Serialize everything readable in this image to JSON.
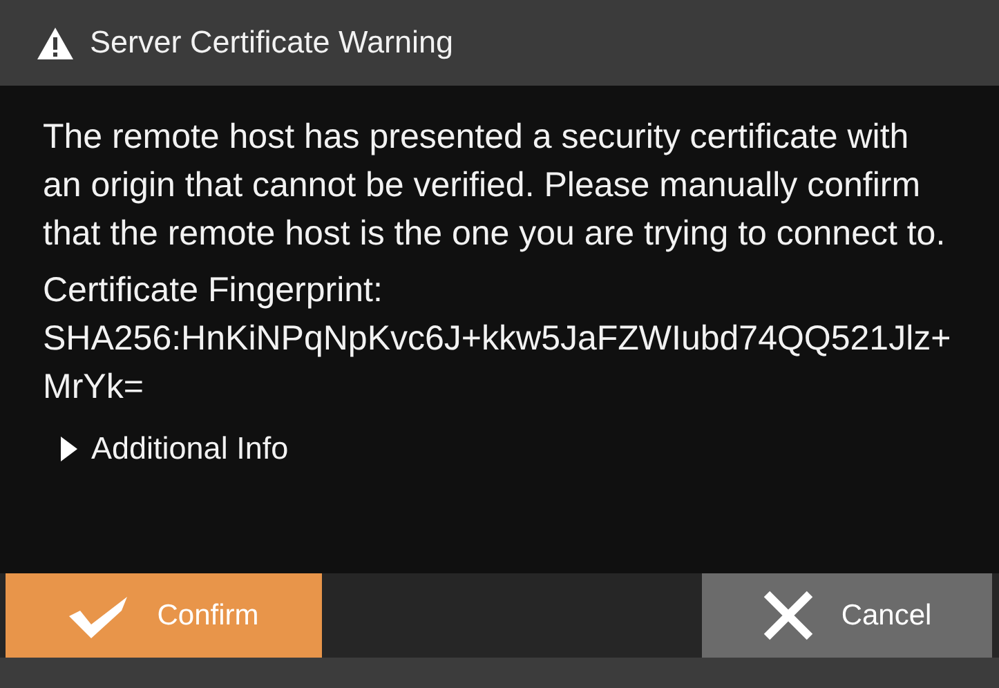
{
  "window": {
    "title": "Server Certificate Warning"
  },
  "message": "The remote host has presented a security certificate with an origin that cannot be verified. Please manually confirm that the remote host is the one you are trying to connect to.",
  "fingerprint_label": "Certificate Fingerprint:",
  "fingerprint": "SHA256:HnKiNPqNpKvc6J+kkw5JaFZWIubd74QQ521Jlz+MrYk=",
  "additional_info": {
    "label": "Additional Info",
    "expanded": false
  },
  "buttons": [
    {
      "kind": "confirm",
      "label": "Confirm"
    },
    {
      "kind": "cancel",
      "label": "Cancel"
    }
  ]
}
